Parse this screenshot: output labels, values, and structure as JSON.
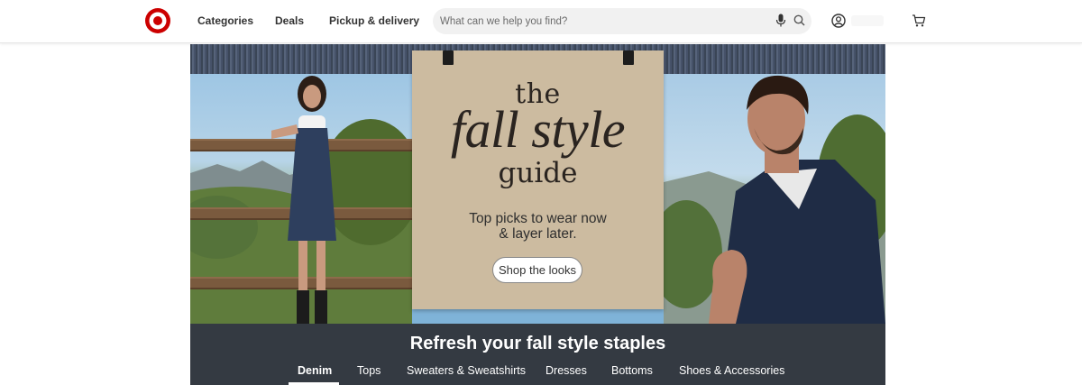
{
  "header": {
    "logo_alt": "Target",
    "nav": [
      {
        "label": "Categories"
      },
      {
        "label": "Deals"
      },
      {
        "label": "Pickup & delivery"
      }
    ],
    "search": {
      "placeholder": "What can we help you find?",
      "value": "",
      "mic_icon": "microphone-icon",
      "search_icon": "search-icon"
    },
    "account_icon": "account-icon",
    "cart_icon": "cart-icon"
  },
  "hero": {
    "line1": "the",
    "line2": "fall style",
    "line3": "guide",
    "tagline1": "Top picks to wear now",
    "tagline2": "& layer later.",
    "cta": "Shop the looks"
  },
  "categories": {
    "title": "Refresh your fall style staples",
    "tabs": [
      {
        "label": "Denim",
        "active": true
      },
      {
        "label": "Tops",
        "active": false
      },
      {
        "label": "Sweaters & Sweatshirts",
        "active": false
      },
      {
        "label": "Dresses",
        "active": false
      },
      {
        "label": "Bottoms",
        "active": false
      },
      {
        "label": "Shoes & Accessories",
        "active": false
      }
    ]
  },
  "colors": {
    "brand_red": "#cc0000",
    "band_dark": "#343a42",
    "sign_tan": "#ccbba0"
  }
}
